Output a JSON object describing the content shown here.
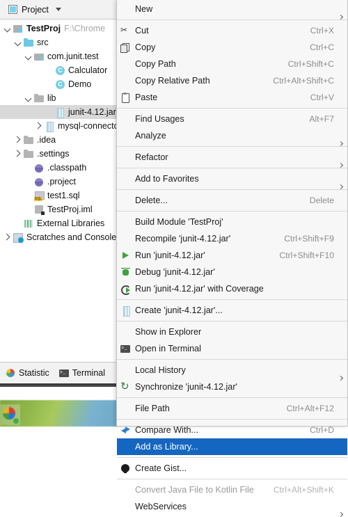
{
  "panel": {
    "title": "Project",
    "icon": "project-icon",
    "dropdown_icon": "chevron-down-icon"
  },
  "tree": [
    {
      "indent": 0,
      "arrow": "open",
      "icon": "module-icon",
      "label": "TestProj",
      "bold": true,
      "dim": "F:\\Chrome",
      "selected": false
    },
    {
      "indent": 1,
      "arrow": "open",
      "icon": "folder-icon",
      "label": "src",
      "bold": false,
      "dim": "",
      "selected": false
    },
    {
      "indent": 2,
      "arrow": "open",
      "icon": "package-icon",
      "label": "com.junit.test",
      "bold": false,
      "dim": "",
      "selected": false
    },
    {
      "indent": 4,
      "arrow": "none",
      "icon": "class-icon",
      "label": "Calculator",
      "bold": false,
      "dim": "",
      "selected": false
    },
    {
      "indent": 4,
      "arrow": "none",
      "icon": "class-icon",
      "label": "Demo",
      "bold": false,
      "dim": "",
      "selected": false
    },
    {
      "indent": 2,
      "arrow": "open",
      "icon": "folder-gray-icon",
      "label": "lib",
      "bold": false,
      "dim": "",
      "selected": false
    },
    {
      "indent": 4,
      "arrow": "none",
      "icon": "jar-icon",
      "label": "junit-4.12.jar",
      "bold": false,
      "dim": "",
      "selected": true
    },
    {
      "indent": 3,
      "arrow": "closed",
      "icon": "jar-icon",
      "label": "mysql-connector",
      "bold": false,
      "dim": "",
      "selected": false
    },
    {
      "indent": 1,
      "arrow": "closed",
      "icon": "folder-gray-icon",
      "label": ".idea",
      "bold": false,
      "dim": "",
      "selected": false
    },
    {
      "indent": 1,
      "arrow": "closed",
      "icon": "folder-gray-icon",
      "label": ".settings",
      "bold": false,
      "dim": "",
      "selected": false
    },
    {
      "indent": 2,
      "arrow": "none",
      "icon": "orb-icon",
      "label": ".classpath",
      "bold": false,
      "dim": "",
      "selected": false
    },
    {
      "indent": 2,
      "arrow": "none",
      "icon": "orb-icon",
      "label": ".project",
      "bold": false,
      "dim": "",
      "selected": false
    },
    {
      "indent": 2,
      "arrow": "none",
      "icon": "sql-file-icon",
      "label": "test1.sql",
      "bold": false,
      "dim": "",
      "selected": false
    },
    {
      "indent": 2,
      "arrow": "none",
      "icon": "iml-file-icon",
      "label": "TestProj.iml",
      "bold": false,
      "dim": "",
      "selected": false
    },
    {
      "indent": 1,
      "arrow": "none",
      "icon": "libraries-icon",
      "label": "External Libraries",
      "bold": false,
      "dim": "",
      "selected": false
    },
    {
      "indent": 0,
      "arrow": "closed",
      "icon": "scratches-icon",
      "label": "Scratches and Consoles",
      "bold": false,
      "dim": "",
      "selected": false
    }
  ],
  "tool_tabs": [
    {
      "label": "Statistic",
      "icon": "statistic-icon"
    },
    {
      "label": "Terminal",
      "icon": "terminal-icon"
    }
  ],
  "context_menu": {
    "items": [
      {
        "label": "New",
        "key": "",
        "icon": "",
        "submenu": true,
        "selected": false,
        "disabled": false,
        "mnemonic": "N",
        "sep_after": true
      },
      {
        "label": "Cut",
        "key": "Ctrl+X",
        "icon": "cut-icon",
        "submenu": false,
        "selected": false,
        "disabled": false,
        "mnemonic": "t",
        "sep_after": false
      },
      {
        "label": "Copy",
        "key": "Ctrl+C",
        "icon": "copy-icon",
        "submenu": false,
        "selected": false,
        "disabled": false,
        "mnemonic": "C",
        "sep_after": false
      },
      {
        "label": "Copy Path",
        "key": "Ctrl+Shift+C",
        "icon": "",
        "submenu": false,
        "selected": false,
        "disabled": false,
        "mnemonic": "o",
        "sep_after": false
      },
      {
        "label": "Copy Relative Path",
        "key": "Ctrl+Alt+Shift+C",
        "icon": "",
        "submenu": false,
        "selected": false,
        "disabled": false,
        "mnemonic": "y",
        "sep_after": false
      },
      {
        "label": "Paste",
        "key": "Ctrl+V",
        "icon": "paste-icon",
        "submenu": false,
        "selected": false,
        "disabled": false,
        "mnemonic": "P",
        "sep_after": true
      },
      {
        "label": "Find Usages",
        "key": "Alt+F7",
        "icon": "",
        "submenu": false,
        "selected": false,
        "disabled": false,
        "mnemonic": "U",
        "sep_after": false
      },
      {
        "label": "Analyze",
        "key": "",
        "icon": "",
        "submenu": true,
        "selected": false,
        "disabled": false,
        "mnemonic": "",
        "sep_after": true
      },
      {
        "label": "Refactor",
        "key": "",
        "icon": "",
        "submenu": true,
        "selected": false,
        "disabled": false,
        "mnemonic": "R",
        "sep_after": true
      },
      {
        "label": "Add to Favorites",
        "key": "",
        "icon": "",
        "submenu": true,
        "selected": false,
        "disabled": false,
        "mnemonic": "a",
        "sep_after": true
      },
      {
        "label": "Delete...",
        "key": "Delete",
        "icon": "",
        "submenu": false,
        "selected": false,
        "disabled": false,
        "mnemonic": "D",
        "sep_after": true
      },
      {
        "label": "Build Module 'TestProj'",
        "key": "",
        "icon": "",
        "submenu": false,
        "selected": false,
        "disabled": false,
        "mnemonic": "M",
        "sep_after": false
      },
      {
        "label": "Recompile 'junit-4.12.jar'",
        "key": "Ctrl+Shift+F9",
        "icon": "",
        "submenu": false,
        "selected": false,
        "disabled": false,
        "mnemonic": "e",
        "sep_after": false
      },
      {
        "label": "Run 'junit-4.12.jar'",
        "key": "Ctrl+Shift+F10",
        "icon": "run-icon",
        "submenu": false,
        "selected": false,
        "disabled": false,
        "mnemonic": "u",
        "sep_after": false
      },
      {
        "label": "Debug 'junit-4.12.jar'",
        "key": "",
        "icon": "debug-icon",
        "submenu": false,
        "selected": false,
        "disabled": false,
        "mnemonic": "D",
        "sep_after": false
      },
      {
        "label": "Run 'junit-4.12.jar' with Coverage",
        "key": "",
        "icon": "coverage-icon",
        "submenu": false,
        "selected": false,
        "disabled": false,
        "mnemonic": "v",
        "sep_after": true
      },
      {
        "label": "Create 'junit-4.12.jar'...",
        "key": "",
        "icon": "jar-icon",
        "submenu": false,
        "selected": false,
        "disabled": false,
        "mnemonic": "",
        "sep_after": true
      },
      {
        "label": "Show in Explorer",
        "key": "",
        "icon": "",
        "submenu": false,
        "selected": false,
        "disabled": false,
        "mnemonic": "",
        "sep_after": false
      },
      {
        "label": "Open in Terminal",
        "key": "",
        "icon": "terminal-icon",
        "submenu": false,
        "selected": false,
        "disabled": false,
        "mnemonic": "",
        "sep_after": true
      },
      {
        "label": "Local History",
        "key": "",
        "icon": "",
        "submenu": true,
        "selected": false,
        "disabled": false,
        "mnemonic": "H",
        "sep_after": false
      },
      {
        "label": "Synchronize 'junit-4.12.jar'",
        "key": "",
        "icon": "sync-icon",
        "submenu": false,
        "selected": false,
        "disabled": false,
        "mnemonic": "",
        "sep_after": true
      },
      {
        "label": "File Path",
        "key": "Ctrl+Alt+F12",
        "icon": "",
        "submenu": false,
        "selected": false,
        "disabled": false,
        "mnemonic": "P",
        "sep_after": true
      },
      {
        "label": "Compare With...",
        "key": "Ctrl+D",
        "icon": "compare-icon",
        "submenu": false,
        "selected": false,
        "disabled": false,
        "mnemonic": "",
        "sep_after": false
      },
      {
        "label": "Add as Library...",
        "key": "",
        "icon": "",
        "submenu": false,
        "selected": true,
        "disabled": false,
        "mnemonic": "",
        "sep_after": true
      },
      {
        "label": "Create Gist...",
        "key": "",
        "icon": "github-icon",
        "submenu": false,
        "selected": false,
        "disabled": false,
        "mnemonic": "",
        "sep_after": true
      },
      {
        "label": "Convert Java File to Kotlin File",
        "key": "Ctrl+Alt+Shift+K",
        "icon": "",
        "submenu": false,
        "selected": false,
        "disabled": true,
        "mnemonic": "",
        "sep_after": false
      },
      {
        "label": "WebServices",
        "key": "",
        "icon": "",
        "submenu": true,
        "selected": false,
        "disabled": false,
        "mnemonic": "",
        "sep_after": false
      }
    ]
  },
  "colors": {
    "selection_blue": "#1566c0",
    "menu_bg": "#f7f7f7",
    "tree_selection": "#d9d9d9",
    "folder_blue": "#6cc9e8",
    "shortcut_gray": "#8d8d8d"
  }
}
